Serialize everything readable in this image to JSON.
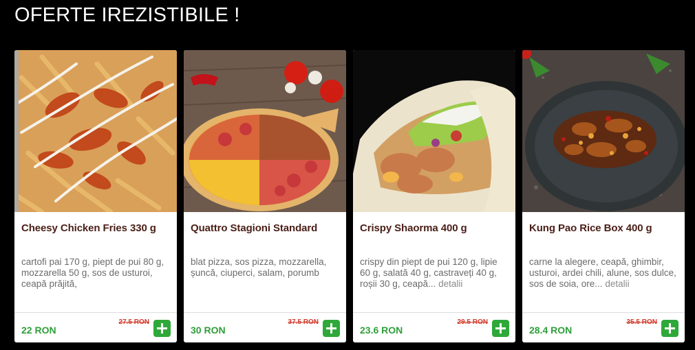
{
  "header": {
    "title": "OFERTE IREZISTIBILE !"
  },
  "colors": {
    "background": "#000000",
    "title_text": "#ffffff",
    "product_name": "#4a1f17",
    "price": "#2e9e3a",
    "old_price": "#d23a2b",
    "add_button": "#2fa83a"
  },
  "products": [
    {
      "name": "Cheesy Chicken Fries 330 g",
      "description": "cartofi pai 170 g, piept de pui 80 g, mozzarella 50 g, sos de usturoi, ceapă prăjită,",
      "more": "",
      "price": "22 RON",
      "old_price": "27.5 RON",
      "image": "cheesy-chicken-fries-photo"
    },
    {
      "name": "Quattro Stagioni Standard",
      "description": "blat pizza, sos pizza, mozzarella, șuncă, ciuperci, salam, porumb",
      "more": "",
      "price": "30 RON",
      "old_price": "37.5 RON",
      "image": "quattro-stagioni-pizza-photo"
    },
    {
      "name": "Crispy Shaorma 400 g",
      "description": "crispy din piept de pui 120 g, lipie 60 g, salată 40 g, castraveți 40 g, roșii 30 g, ceapă...",
      "more": "detalii",
      "price": "23.6 RON",
      "old_price": "29.5 RON",
      "image": "crispy-shaorma-photo"
    },
    {
      "name": "Kung Pao Rice Box 400 g",
      "description": "carne la alegere, ceapă, ghimbir, usturoi, ardei chili, alune, sos dulce, sos de soia, ore...",
      "more": "detalii",
      "price": "28.4 RON",
      "old_price": "35.5 RON",
      "image": "kung-pao-rice-box-photo"
    }
  ]
}
